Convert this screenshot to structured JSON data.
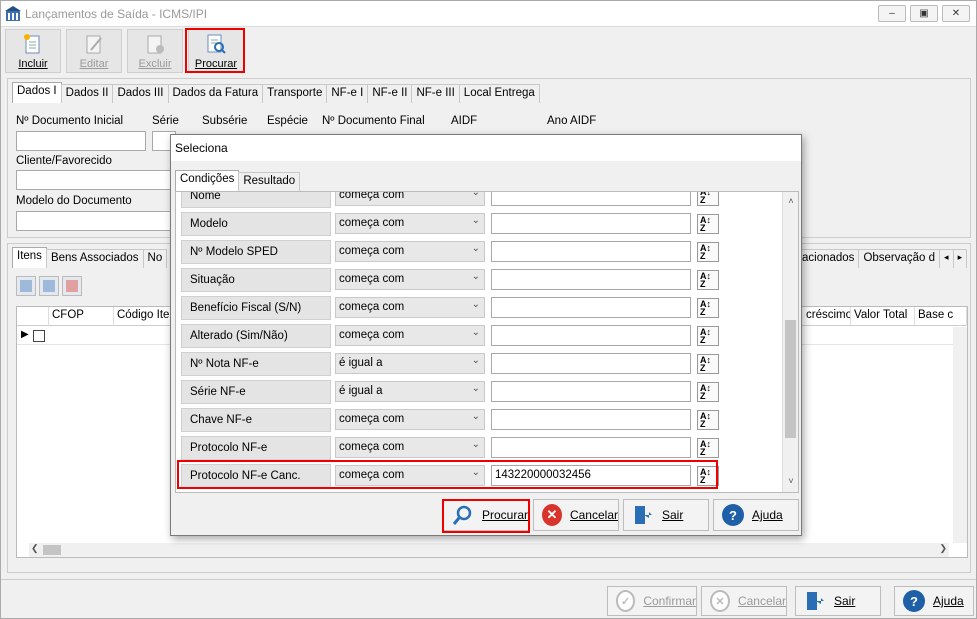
{
  "window": {
    "title": "Lançamentos de Saída - ICMS/IPI",
    "controls": [
      "minimize",
      "restore",
      "close"
    ]
  },
  "toolbar": {
    "items": [
      {
        "label": "Incluir",
        "icon": "new-document-icon",
        "enabled": true
      },
      {
        "label": "Editar",
        "icon": "edit-document-icon",
        "enabled": false
      },
      {
        "label": "Excluir",
        "icon": "delete-document-icon",
        "enabled": false
      },
      {
        "label": "Procurar",
        "icon": "search-document-icon",
        "enabled": true,
        "highlighted": true
      }
    ]
  },
  "main_tabs": [
    "Dados I",
    "Dados II",
    "Dados III",
    "Dados da Fatura",
    "Transporte",
    "NF-e I",
    "NF-e II",
    "NF-e III",
    "Local Entrega"
  ],
  "main_tabs_active": "Dados I",
  "form": {
    "doc_inicial": "Nº Documento Inicial",
    "serie": "Série",
    "subserie": "Subsérie",
    "especie": "Espécie",
    "doc_final": "Nº Documento Final",
    "aidf": "AIDF",
    "ano_aidf": "Ano AIDF",
    "cliente": "Cliente/Favorecido",
    "modelo": "Modelo do Documento"
  },
  "lower_tabs": {
    "left": [
      "Itens",
      "Bens Associados",
      "No"
    ],
    "right": [
      "acionados",
      "Observação d"
    ]
  },
  "grid": {
    "columns_left": [
      "CFOP",
      "Código Iter"
    ],
    "columns_right": [
      "créscimo",
      "Valor Total",
      "Base c"
    ]
  },
  "footer": {
    "confirmar": "Confirmar",
    "cancelar": "Cancelar",
    "sair": "Sair",
    "ajuda": "Ajuda"
  },
  "dialog": {
    "title": "Seleciona",
    "tabs": [
      "Condições",
      "Resultado"
    ],
    "rows": [
      {
        "field": "Nome",
        "condition": "começa com",
        "value": ""
      },
      {
        "field": "Modelo",
        "condition": "começa com",
        "value": ""
      },
      {
        "field": "Nº Modelo SPED",
        "condition": "começa com",
        "value": ""
      },
      {
        "field": "Situação",
        "condition": "começa com",
        "value": ""
      },
      {
        "field": "Benefício Fiscal (S/N)",
        "condition": "começa com",
        "value": ""
      },
      {
        "field": "Alterado (Sim/Não)",
        "condition": "começa com",
        "value": ""
      },
      {
        "field": "Nº Nota NF-e",
        "condition": "é igual a",
        "value": ""
      },
      {
        "field": "Série NF-e",
        "condition": "é igual a",
        "value": ""
      },
      {
        "field": "Chave NF-e",
        "condition": "começa com",
        "value": ""
      },
      {
        "field": "Protocolo NF-e",
        "condition": "começa com",
        "value": ""
      },
      {
        "field": "Protocolo NF-e Canc.",
        "condition": "começa com",
        "value": "143220000032456",
        "highlighted": true
      }
    ],
    "buttons": {
      "procurar": "Procurar",
      "cancelar": "Cancelar",
      "sair": "Sair",
      "ajuda": "Ajuda"
    }
  },
  "colors": {
    "highlight": "#e00000",
    "accent_blue": "#2a6fb6",
    "cancel_red": "#d9342b",
    "help_blue": "#1f5fa8"
  }
}
